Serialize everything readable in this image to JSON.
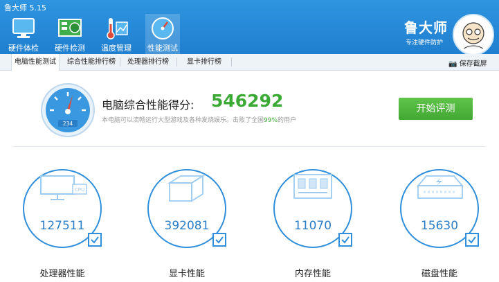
{
  "app": {
    "title": "鲁大师 5.15"
  },
  "nav": [
    {
      "label": "硬件体检",
      "icon": "monitor-icon"
    },
    {
      "label": "硬件检测",
      "icon": "circuit-board-icon"
    },
    {
      "label": "温度管理",
      "icon": "thermometer-icon"
    },
    {
      "label": "性能测试",
      "icon": "speedometer-icon"
    }
  ],
  "brand": {
    "name": "鲁大师",
    "slogan": "专注硬件防护",
    "avatar_icon": "mascot-avatar-icon"
  },
  "tabs": [
    {
      "label": "电脑性能测试"
    },
    {
      "label": "综合性能排行榜"
    },
    {
      "label": "处理器排行榜"
    },
    {
      "label": "显卡排行榜"
    }
  ],
  "toolbar": {
    "screenshot_label": "保存截屏"
  },
  "score": {
    "title": "电脑综合性能得分:",
    "value": "546292",
    "gauge_reading": "234",
    "desc_prefix": "本电脑可以流畅运行大型游戏及各种发烧娱乐。击败了全国",
    "desc_percent": "99%",
    "desc_suffix": "的用户",
    "start_label": "开始评测"
  },
  "metrics": [
    {
      "value": "127511",
      "label": "处理器性能",
      "icon": "cpu-monitor-icon",
      "chip_text": "CPU"
    },
    {
      "value": "392081",
      "label": "显卡性能",
      "icon": "graphics-cube-icon"
    },
    {
      "value": "11070",
      "label": "内存性能",
      "icon": "memory-chip-icon"
    },
    {
      "value": "15630",
      "label": "磁盘性能",
      "icon": "hard-disk-icon"
    }
  ],
  "colors": {
    "accent": "#2f8fdc",
    "green": "#3aaa35",
    "topbar": "#2185d6"
  }
}
